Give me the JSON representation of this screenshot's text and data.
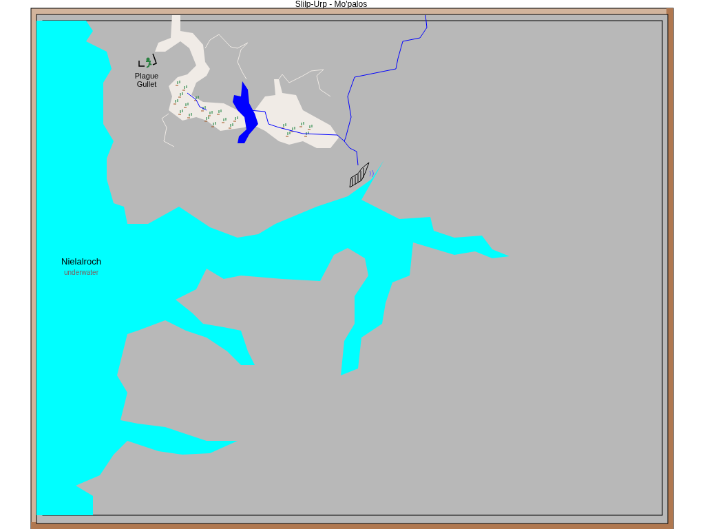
{
  "window": {
    "title": "Slilp-Urp - Mo'palos"
  },
  "places": [
    {
      "kind": "town",
      "lines": [
        "Plague",
        "Gullet"
      ]
    },
    {
      "kind": "region",
      "lines": [
        "Nielalroch",
        "underwater"
      ]
    }
  ]
}
